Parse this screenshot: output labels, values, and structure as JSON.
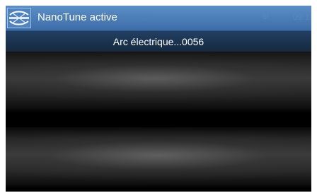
{
  "header": {
    "app_title": "NanoTune active",
    "icon": "nanotune-logo-icon",
    "background_color": "#4a7cba",
    "ghost_status_text": "mo 0.25",
    "ghost_gear_icon": "gear-icon",
    "ghost_time": "09:18"
  },
  "subheader": {
    "status_text": "Arc électrique...0056",
    "background_color": "#1b3350"
  },
  "fiber_view": {
    "description_icon": "fiber-camera-view"
  }
}
